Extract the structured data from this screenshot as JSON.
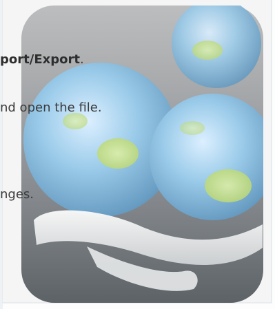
{
  "steps": {
    "step1_prefix": "port/",
    "step1_bold": "Export",
    "step1_suffix": ".",
    "step2": "nd open the file.",
    "step3": "nges."
  },
  "icons": {
    "artwork": "globe-stack-icon"
  },
  "colors": {
    "background": "#f5f5f5",
    "border": "#e8ecef",
    "text": "#3a3a3a",
    "globe_blue": "#8fc3e4",
    "globe_green": "#c9dd7a",
    "tray_gray": "#555b60"
  }
}
